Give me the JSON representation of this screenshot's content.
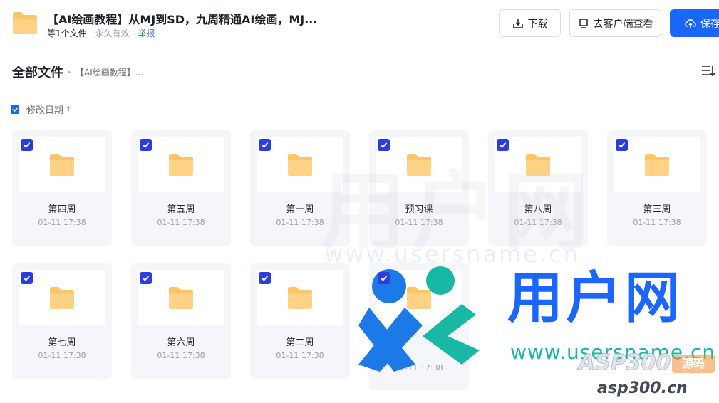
{
  "header": {
    "title": "【AI绘画教程】从MJ到SD，九周精通AI绘画，MJ...",
    "file_count": "等1个文件",
    "validity": "永久有效",
    "report_label": "举报",
    "download_label": "下载",
    "client_label": "去客户端查看",
    "save_label": "保存"
  },
  "breadcrumb": {
    "root": "全部文件",
    "separator": "▸",
    "current": "【AI绘画教程】..."
  },
  "sort": {
    "label": "修改日期",
    "arrows": "⇕"
  },
  "folders": [
    {
      "name": "第四周",
      "date": "01-11 17:38"
    },
    {
      "name": "第五周",
      "date": "01-11 17:38"
    },
    {
      "name": "第一周",
      "date": "01-11 17:38"
    },
    {
      "name": "预习课",
      "date": "01-11 17:38"
    },
    {
      "name": "第八周",
      "date": "01-11 17:38"
    },
    {
      "name": "第三周",
      "date": "01-11 17:38"
    },
    {
      "name": "第七周",
      "date": "01-11 17:38"
    },
    {
      "name": "第六周",
      "date": "01-11 17:38"
    },
    {
      "name": "第二周",
      "date": "01-11 17:38"
    },
    {
      "name": "",
      "date": "01-11 17:38"
    }
  ],
  "watermark": {
    "brand": "用户网",
    "url": "www.usersname.cn",
    "asp": "ASP300",
    "badge": "源码",
    "domain": "asp300.cn"
  },
  "colors": {
    "primary": "#1b66ff",
    "checkbox": "#2d3ce0",
    "folder": "#ffc466",
    "teal": "#19b7a5"
  }
}
